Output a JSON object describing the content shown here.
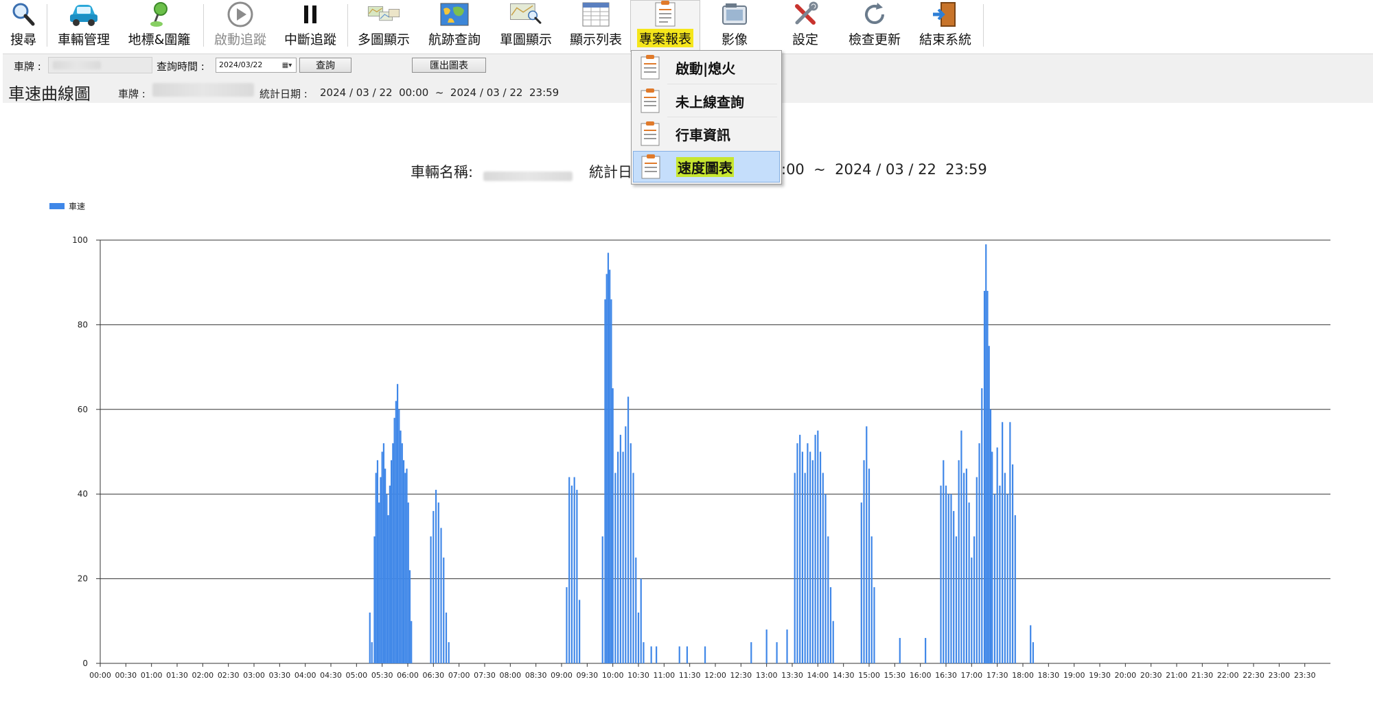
{
  "toolbar": {
    "items": [
      {
        "label": "搜尋",
        "icon": "search-icon"
      },
      {
        "label": "車輛管理",
        "icon": "car-icon"
      },
      {
        "label": "地標&圍籬",
        "icon": "landmark-pin-icon"
      },
      {
        "label": "啟動追蹤",
        "icon": "play-icon"
      },
      {
        "label": "中斷追蹤",
        "icon": "pause-icon"
      },
      {
        "label": "多圖顯示",
        "icon": "multi-map-icon"
      },
      {
        "label": "航跡查詢",
        "icon": "world-map-icon"
      },
      {
        "label": "單圖顯示",
        "icon": "single-map-icon"
      },
      {
        "label": "顯示列表",
        "icon": "table-list-icon"
      },
      {
        "label": "專案報表",
        "icon": "report-icon"
      },
      {
        "label": "影像",
        "icon": "camera-icon"
      },
      {
        "label": "設定",
        "icon": "tools-icon"
      },
      {
        "label": "檢查更新",
        "icon": "refresh-icon"
      },
      {
        "label": "結束系統",
        "icon": "exit-door-icon"
      }
    ]
  },
  "filter": {
    "plate_label": "車牌 :",
    "query_time_label": "查詢時間 :",
    "date_value": "2024/03/22",
    "query_button": "查詢",
    "export_button": "匯出圖表"
  },
  "report": {
    "title": "車速曲線圖",
    "plate_label": "車牌 :",
    "stat_date_label": "統計日期 :",
    "stat_date_value": "2024 / 03 / 22  00:00  ~  2024 / 03 / 22  23:59"
  },
  "chart_header": {
    "vehicle_name_label": "車輛名稱:",
    "stat_label_partial": "統計日",
    "range_partial": ":00  ~  2024 / 03 / 22  23:59"
  },
  "dropdown": {
    "items": [
      {
        "label": "啟動|熄火"
      },
      {
        "label": "未上線查詢"
      },
      {
        "label": "行車資訊"
      },
      {
        "label": "速度圖表"
      }
    ],
    "selected_index": 3
  },
  "colors": {
    "bar": "#3f87e8",
    "highlight_yellow": "#f5e61b",
    "menu_selected": "#c5defb",
    "menu_label_highlight": "#c7e630"
  },
  "chart_data": {
    "type": "bar",
    "legend": [
      "車速"
    ],
    "legend_position": "top-left",
    "x_unit": "hours",
    "xlim": [
      0,
      24
    ],
    "ylim": [
      0,
      100
    ],
    "y_ticks": [
      0,
      20,
      40,
      60,
      80,
      100
    ],
    "x_tick_labels": [
      "00:00",
      "00:30",
      "01:00",
      "01:30",
      "02:00",
      "02:30",
      "03:00",
      "03:30",
      "04:00",
      "04:30",
      "05:00",
      "05:30",
      "06:00",
      "06:30",
      "07:00",
      "07:30",
      "08:00",
      "08:30",
      "09:00",
      "09:30",
      "10:00",
      "10:30",
      "11:00",
      "11:30",
      "12:00",
      "12:30",
      "13:00",
      "13:30",
      "14:00",
      "14:30",
      "15:00",
      "15:30",
      "16:00",
      "16:30",
      "17:00",
      "17:30",
      "18:00",
      "18:30",
      "19:00",
      "19:30",
      "20:00",
      "20:30",
      "21:00",
      "21:30",
      "22:00",
      "22:30",
      "23:00",
      "23:30"
    ],
    "grid": "horizontal",
    "series": [
      {
        "name": "車速",
        "points": [
          [
            5.26,
            12
          ],
          [
            5.3,
            5
          ],
          [
            5.35,
            30
          ],
          [
            5.38,
            45
          ],
          [
            5.41,
            48
          ],
          [
            5.44,
            38
          ],
          [
            5.47,
            44
          ],
          [
            5.5,
            50
          ],
          [
            5.53,
            52
          ],
          [
            5.56,
            46
          ],
          [
            5.59,
            40
          ],
          [
            5.62,
            35
          ],
          [
            5.65,
            42
          ],
          [
            5.68,
            48
          ],
          [
            5.71,
            52
          ],
          [
            5.74,
            58
          ],
          [
            5.77,
            62
          ],
          [
            5.8,
            66
          ],
          [
            5.83,
            60
          ],
          [
            5.86,
            55
          ],
          [
            5.89,
            52
          ],
          [
            5.92,
            48
          ],
          [
            5.95,
            45
          ],
          [
            5.98,
            46
          ],
          [
            6.01,
            38
          ],
          [
            6.04,
            22
          ],
          [
            6.07,
            10
          ],
          [
            6.45,
            30
          ],
          [
            6.5,
            36
          ],
          [
            6.55,
            41
          ],
          [
            6.6,
            38
          ],
          [
            6.65,
            32
          ],
          [
            6.7,
            25
          ],
          [
            6.75,
            12
          ],
          [
            6.8,
            5
          ],
          [
            9.1,
            18
          ],
          [
            9.15,
            44
          ],
          [
            9.2,
            42
          ],
          [
            9.25,
            44
          ],
          [
            9.3,
            41
          ],
          [
            9.35,
            15
          ],
          [
            9.8,
            30
          ],
          [
            9.85,
            86
          ],
          [
            9.88,
            92
          ],
          [
            9.91,
            97
          ],
          [
            9.94,
            93
          ],
          [
            9.97,
            86
          ],
          [
            10.0,
            65
          ],
          [
            10.05,
            45
          ],
          [
            10.1,
            50
          ],
          [
            10.15,
            54
          ],
          [
            10.2,
            50
          ],
          [
            10.25,
            56
          ],
          [
            10.3,
            63
          ],
          [
            10.35,
            52
          ],
          [
            10.4,
            45
          ],
          [
            10.45,
            25
          ],
          [
            10.5,
            12
          ],
          [
            10.55,
            20
          ],
          [
            10.6,
            5
          ],
          [
            10.75,
            4
          ],
          [
            10.85,
            4
          ],
          [
            11.3,
            4
          ],
          [
            11.45,
            4
          ],
          [
            11.8,
            4
          ],
          [
            12.7,
            5
          ],
          [
            13.0,
            8
          ],
          [
            13.2,
            5
          ],
          [
            13.4,
            8
          ],
          [
            13.55,
            45
          ],
          [
            13.6,
            52
          ],
          [
            13.65,
            54
          ],
          [
            13.7,
            50
          ],
          [
            13.75,
            45
          ],
          [
            13.8,
            52
          ],
          [
            13.85,
            50
          ],
          [
            13.9,
            48
          ],
          [
            13.95,
            54
          ],
          [
            14.0,
            55
          ],
          [
            14.05,
            50
          ],
          [
            14.1,
            45
          ],
          [
            14.15,
            40
          ],
          [
            14.2,
            30
          ],
          [
            14.25,
            18
          ],
          [
            14.3,
            10
          ],
          [
            14.85,
            38
          ],
          [
            14.9,
            48
          ],
          [
            14.95,
            56
          ],
          [
            15.0,
            46
          ],
          [
            15.05,
            30
          ],
          [
            15.1,
            18
          ],
          [
            15.6,
            6
          ],
          [
            16.1,
            6
          ],
          [
            16.4,
            42
          ],
          [
            16.45,
            48
          ],
          [
            16.5,
            42
          ],
          [
            16.55,
            40
          ],
          [
            16.6,
            40
          ],
          [
            16.65,
            36
          ],
          [
            16.7,
            30
          ],
          [
            16.75,
            48
          ],
          [
            16.8,
            55
          ],
          [
            16.85,
            45
          ],
          [
            16.9,
            46
          ],
          [
            16.95,
            38
          ],
          [
            17.0,
            25
          ],
          [
            17.05,
            30
          ],
          [
            17.1,
            44
          ],
          [
            17.15,
            52
          ],
          [
            17.2,
            65
          ],
          [
            17.25,
            88
          ],
          [
            17.28,
            99
          ],
          [
            17.31,
            88
          ],
          [
            17.34,
            75
          ],
          [
            17.37,
            60
          ],
          [
            17.4,
            50
          ],
          [
            17.45,
            40
          ],
          [
            17.5,
            51
          ],
          [
            17.55,
            42
          ],
          [
            17.6,
            57
          ],
          [
            17.65,
            45
          ],
          [
            17.7,
            40
          ],
          [
            17.75,
            57
          ],
          [
            17.8,
            47
          ],
          [
            17.85,
            35
          ],
          [
            18.15,
            9
          ],
          [
            18.2,
            5
          ]
        ]
      }
    ]
  }
}
